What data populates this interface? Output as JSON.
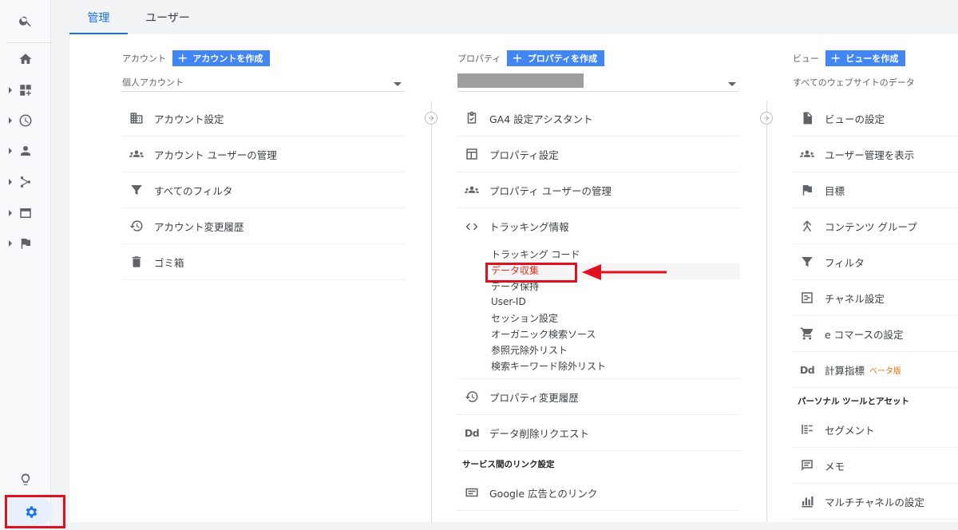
{
  "tabs": {
    "admin": "管理",
    "user": "ユーザー"
  },
  "account": {
    "label": "アカウント",
    "create_label": "アカウントを作成",
    "selector_value": "個人アカウント",
    "items": [
      {
        "label": "アカウント設定",
        "icon": "building-icon"
      },
      {
        "label": "アカウント ユーザーの管理",
        "icon": "people-icon"
      },
      {
        "label": "すべてのフィルタ",
        "icon": "filter-icon"
      },
      {
        "label": "アカウント変更履歴",
        "icon": "history-icon"
      },
      {
        "label": "ゴミ箱",
        "icon": "trash-icon"
      }
    ]
  },
  "property": {
    "label": "プロパティ",
    "create_label": "プロパティを作成",
    "items": [
      {
        "label": "GA4 設定アシスタント",
        "icon": "checklist-icon"
      },
      {
        "label": "プロパティ設定",
        "icon": "layout-icon"
      },
      {
        "label": "プロパティ ユーザーの管理",
        "icon": "people-icon"
      },
      {
        "label": "トラッキング情報",
        "icon": "code-icon"
      }
    ],
    "tracking_sub": [
      "トラッキング コード",
      "データ収集",
      "データ保持",
      "User-ID",
      "セッション設定",
      "オーガニック検索ソース",
      "参照元除外リスト",
      "検索キーワード除外リスト"
    ],
    "items_after": [
      {
        "label": "プロパティ変更履歴",
        "icon": "history-icon"
      },
      {
        "label": "データ削除リクエスト",
        "icon": "dd-icon",
        "text_icon": "Dd"
      }
    ],
    "section_title": "サービス間のリンク設定",
    "link_items": [
      {
        "label": "Google 広告とのリンク",
        "icon": "ads-link-icon"
      }
    ]
  },
  "view": {
    "label": "ビュー",
    "create_label": "ビューを作成",
    "selector_value": "すべてのウェブサイトのデータ",
    "items": [
      {
        "label": "ビューの設定",
        "icon": "document-icon"
      },
      {
        "label": "ユーザー管理を表示",
        "icon": "people-icon"
      },
      {
        "label": "目標",
        "icon": "flag-icon"
      },
      {
        "label": "コンテンツ グループ",
        "icon": "content-group-icon"
      },
      {
        "label": "フィルタ",
        "icon": "filter-icon"
      },
      {
        "label": "チャネル設定",
        "icon": "channel-icon"
      },
      {
        "label": "e コマースの設定",
        "icon": "cart-icon"
      },
      {
        "label": "計算指標",
        "icon": "dd-icon",
        "text_icon": "Dd",
        "badge": "ベータ版"
      }
    ],
    "section_title": "パーソナル ツールとアセット",
    "personal_items": [
      {
        "label": "セグメント",
        "icon": "segment-icon"
      },
      {
        "label": "メモ",
        "icon": "comment-icon"
      },
      {
        "label": "マルチチャネルの設定",
        "icon": "bar-chart-icon"
      }
    ]
  },
  "colors": {
    "accent": "#1a73e8",
    "button": "#4285f4",
    "highlight": "#e0101f",
    "beta": "#e8710a"
  }
}
